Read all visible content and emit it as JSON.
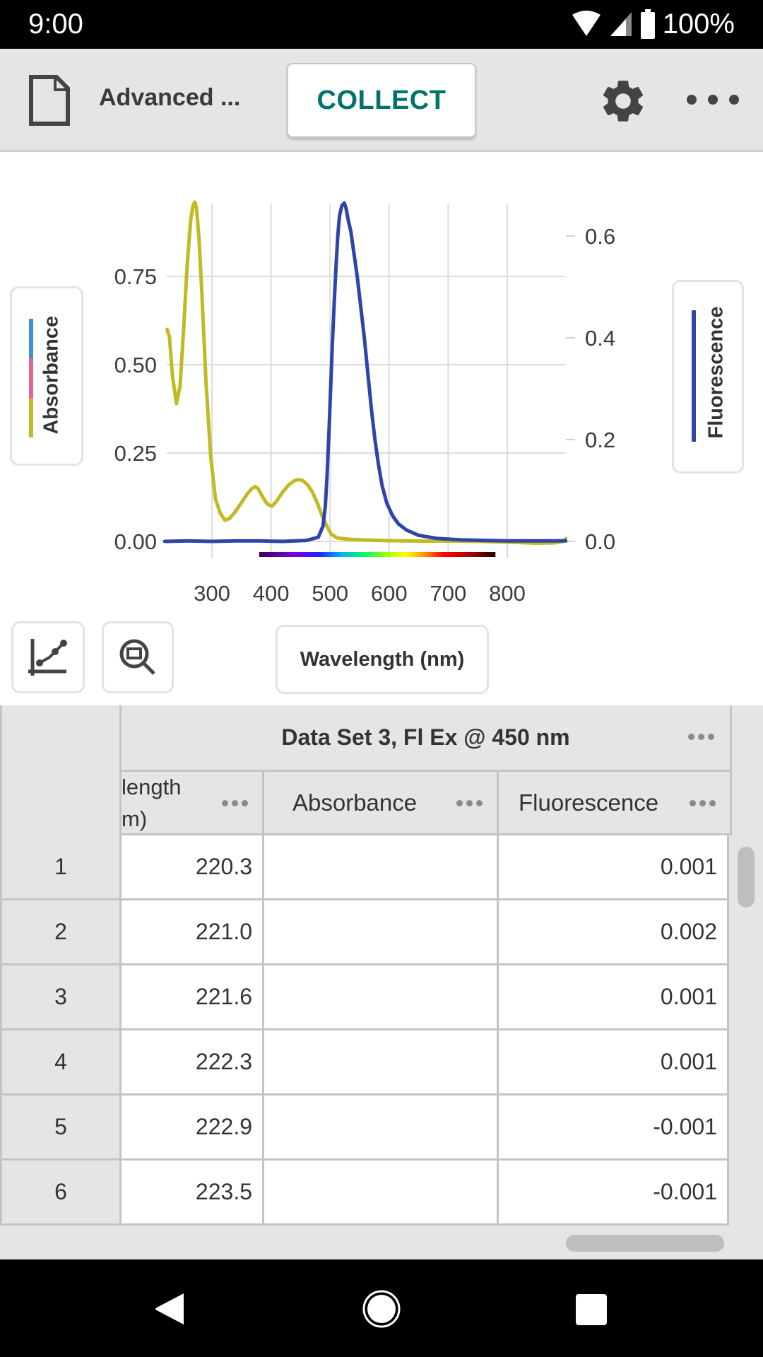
{
  "status_bar": {
    "time": "9:00",
    "battery": "100%",
    "icons": [
      "wifi-icon",
      "cell-signal-icon",
      "battery-icon"
    ]
  },
  "toolbar": {
    "doc_icon": "document-icon",
    "title": "Advanced ...",
    "collect_label": "COLLECT",
    "settings_icon": "gear-icon",
    "more_icon": "more-horizontal-icon"
  },
  "graph": {
    "left_legend": {
      "label": "Absorbance",
      "swatch_colors": [
        "#3d8fd6",
        "#e8609a",
        "#c2ba22"
      ]
    },
    "right_legend": {
      "label": "Fluorescence",
      "swatch_color": "#2f44a8"
    },
    "tools": {
      "graph_options_icon": "graph-options-icon",
      "zoom_icon": "zoom-fit-icon"
    },
    "x_axis_button_label": "Wavelength (nm)"
  },
  "chart_data": {
    "type": "line",
    "title": "",
    "xlabel": "Wavelength (nm)",
    "ylabel": "Absorbance",
    "y2label": "Fluorescence",
    "xlim": [
      220,
      900
    ],
    "ylim": [
      0,
      0.96
    ],
    "y2lim": [
      0,
      0.667
    ],
    "x_ticks": [
      300,
      400,
      500,
      600,
      700,
      800
    ],
    "x_tick_labels": [
      "300",
      "400",
      "500",
      "600",
      "700",
      "800"
    ],
    "y_ticks": [
      0,
      0.25,
      0.5,
      0.75
    ],
    "y_tick_labels": [
      "0.00",
      "0.25",
      "0.50",
      "0.75"
    ],
    "y2_ticks": [
      0,
      0.2,
      0.4,
      0.6
    ],
    "y2_tick_labels": [
      "0.0",
      "0.2",
      "0.4",
      "0.6"
    ],
    "grid": true,
    "visible_spectrum_bar": [
      380,
      780
    ],
    "series": [
      {
        "name": "Absorbance",
        "axis": "left",
        "color": "#c2ba22",
        "x": [
          224,
          228,
          233,
          240,
          246,
          252,
          258,
          264,
          268,
          271,
          274,
          278,
          283,
          290,
          298,
          306,
          314,
          322,
          330,
          340,
          350,
          360,
          368,
          373,
          378,
          386,
          394,
          402,
          410,
          420,
          430,
          440,
          447,
          454,
          462,
          470,
          478,
          486,
          494,
          502,
          512,
          530,
          560,
          600,
          650,
          700,
          750,
          800,
          850,
          880,
          895,
          899
        ],
        "y": [
          0.6,
          0.58,
          0.47,
          0.39,
          0.44,
          0.6,
          0.78,
          0.91,
          0.95,
          0.96,
          0.94,
          0.86,
          0.7,
          0.45,
          0.24,
          0.12,
          0.08,
          0.06,
          0.065,
          0.085,
          0.11,
          0.135,
          0.15,
          0.155,
          0.15,
          0.125,
          0.105,
          0.1,
          0.115,
          0.14,
          0.16,
          0.172,
          0.175,
          0.172,
          0.16,
          0.14,
          0.11,
          0.075,
          0.045,
          0.02,
          0.01,
          0.006,
          0.004,
          0.002,
          0.001,
          0.001,
          0.0,
          -0.002,
          -0.005,
          -0.004,
          0.0,
          0.008
        ]
      },
      {
        "name": "Fluorescence",
        "axis": "right",
        "color": "#2f44a8",
        "x": [
          220,
          260,
          300,
          340,
          380,
          420,
          460,
          480,
          488,
          492,
          495,
          498,
          501,
          504,
          507,
          510,
          513,
          516,
          520,
          524,
          527,
          531,
          535,
          540,
          546,
          552,
          558,
          564,
          570,
          576,
          582,
          588,
          596,
          606,
          616,
          630,
          650,
          680,
          720,
          760,
          800,
          850,
          899
        ],
        "y": [
          0.0,
          0.001,
          0.0,
          0.001,
          0.001,
          0.0,
          0.002,
          0.008,
          0.03,
          0.07,
          0.13,
          0.21,
          0.3,
          0.39,
          0.47,
          0.54,
          0.6,
          0.64,
          0.66,
          0.665,
          0.655,
          0.63,
          0.61,
          0.57,
          0.52,
          0.46,
          0.4,
          0.33,
          0.26,
          0.2,
          0.15,
          0.11,
          0.075,
          0.05,
          0.034,
          0.022,
          0.012,
          0.006,
          0.003,
          0.002,
          0.001,
          0.001,
          0.001
        ]
      }
    ]
  },
  "table": {
    "dataset_title": "Data Set 3, Fl Ex @ 450 nm",
    "columns": [
      {
        "label_line1": "length",
        "label_line2": "m)"
      },
      {
        "label": "Absorbance"
      },
      {
        "label": "Fluorescence"
      }
    ],
    "rows": [
      {
        "index": "1",
        "wavelength": "220.3",
        "absorbance": "",
        "fluorescence": "0.001"
      },
      {
        "index": "2",
        "wavelength": "221.0",
        "absorbance": "",
        "fluorescence": "0.002"
      },
      {
        "index": "3",
        "wavelength": "221.6",
        "absorbance": "",
        "fluorescence": "0.001"
      },
      {
        "index": "4",
        "wavelength": "222.3",
        "absorbance": "",
        "fluorescence": "0.001"
      },
      {
        "index": "5",
        "wavelength": "222.9",
        "absorbance": "",
        "fluorescence": "-0.001"
      },
      {
        "index": "6",
        "wavelength": "223.5",
        "absorbance": "",
        "fluorescence": "-0.001"
      }
    ]
  },
  "nav_bar": {
    "back_icon": "back-icon",
    "home_icon": "home-icon",
    "recents_icon": "recents-icon"
  }
}
